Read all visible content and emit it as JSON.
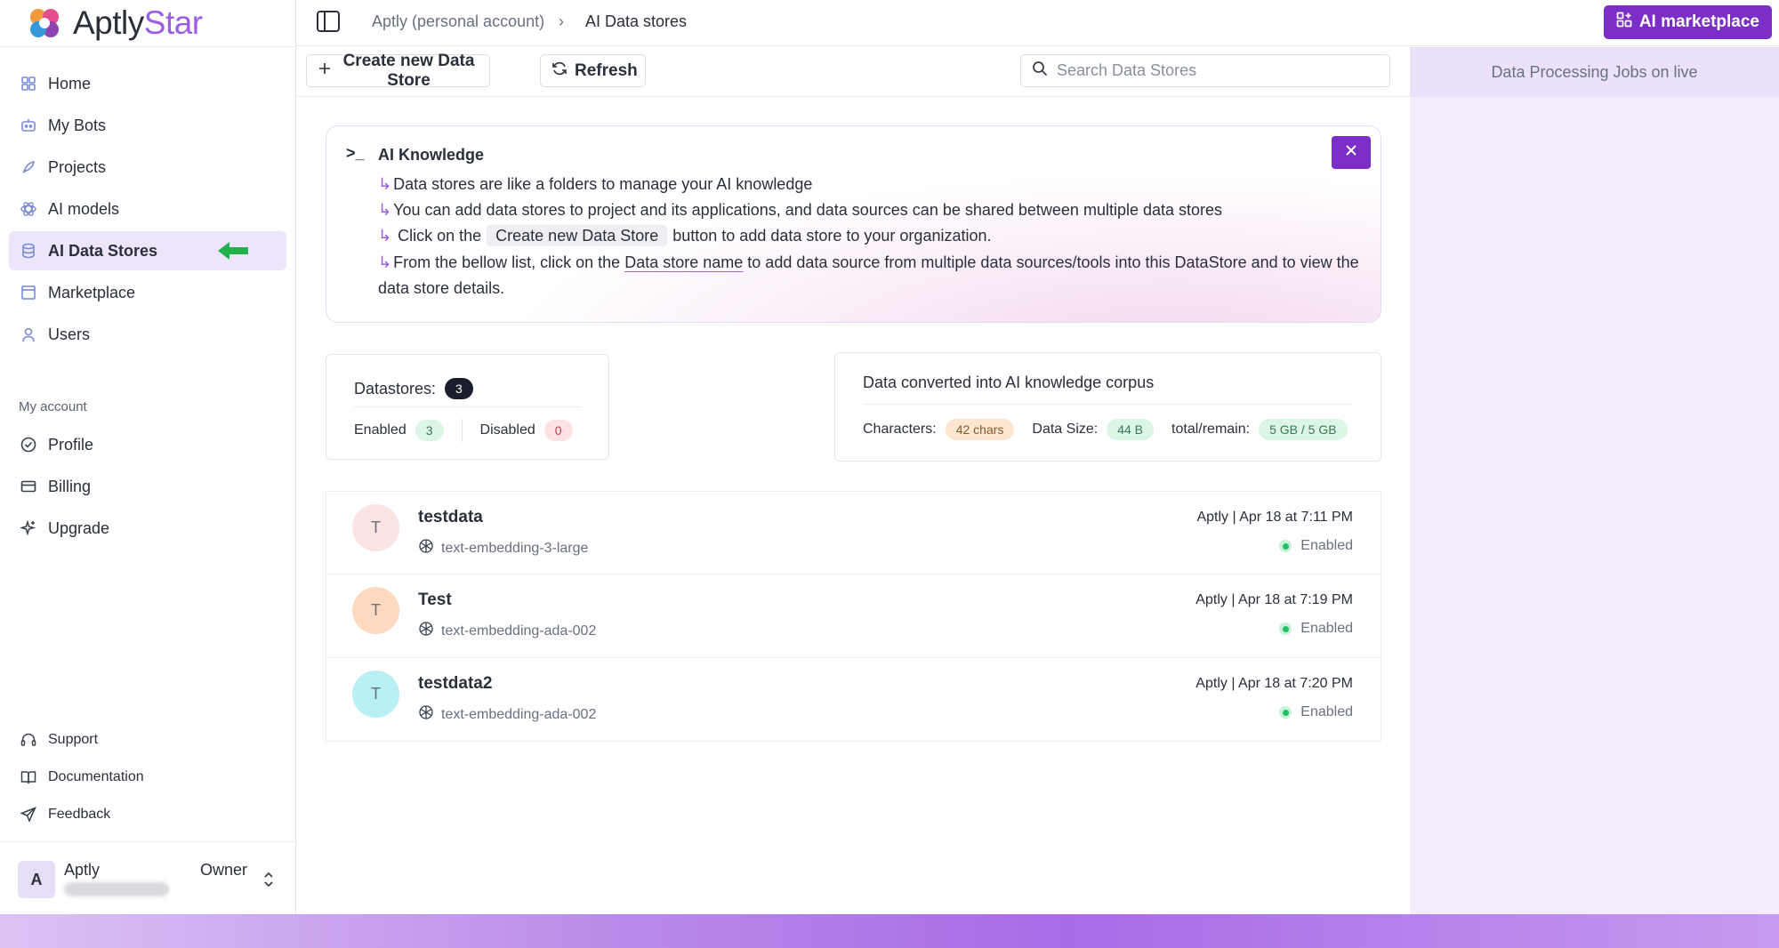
{
  "brand": {
    "name_part1": "Aptly",
    "name_part2": "Star"
  },
  "sidebar": {
    "items": [
      {
        "label": "Home",
        "icon": "home-icon"
      },
      {
        "label": "My Bots",
        "icon": "bot-icon"
      },
      {
        "label": "Projects",
        "icon": "rocket-icon"
      },
      {
        "label": "AI models",
        "icon": "atom-icon"
      },
      {
        "label": "AI Data Stores",
        "icon": "database-icon",
        "active": true
      },
      {
        "label": "Marketplace",
        "icon": "store-icon"
      },
      {
        "label": "Users",
        "icon": "user-icon"
      }
    ],
    "account_section_label": "My account",
    "account_items": [
      {
        "label": "Profile",
        "icon": "check-circle-icon"
      },
      {
        "label": "Billing",
        "icon": "card-icon"
      },
      {
        "label": "Upgrade",
        "icon": "sparkles-icon"
      }
    ],
    "footer_items": [
      {
        "label": "Support",
        "icon": "headset-icon"
      },
      {
        "label": "Documentation",
        "icon": "book-icon"
      },
      {
        "label": "Feedback",
        "icon": "send-icon"
      }
    ],
    "user": {
      "initial": "A",
      "name": "Aptly",
      "role": "Owner"
    }
  },
  "topbar": {
    "breadcrumb_1": "Aptly (personal account)",
    "breadcrumb_sep": "›",
    "breadcrumb_2": "AI Data stores",
    "marketplace_button": "AI marketplace"
  },
  "toolbar": {
    "create_label": "Create new Data Store",
    "refresh_label": "Refresh",
    "search_placeholder": "Search Data Stores"
  },
  "right_panel": {
    "title": "Data Processing Jobs on live"
  },
  "info": {
    "prompt_symbol": ">_",
    "title": "AI Knowledge",
    "hook": "↳",
    "line1": "Data stores are like a folders to manage your AI knowledge",
    "line2": "You can add data stores to project and its applications, and data sources can be shared between multiple data stores",
    "line3_pre": "Click on the",
    "line3_chip": "Create new Data Store",
    "line3_post": "button to add data store to your organization.",
    "line4_pre": "From the bellow list, click on the",
    "line4_link": "Data store name",
    "line4_post": "to add data source from multiple data sources/tools into this DataStore and to view the data store details."
  },
  "stats": {
    "datastores_label": "Datastores:",
    "datastores_count": "3",
    "enabled_label": "Enabled",
    "enabled_count": "3",
    "disabled_label": "Disabled",
    "disabled_count": "0",
    "corpus_title": "Data converted into AI knowledge corpus",
    "characters_label": "Characters:",
    "characters_value": "42 chars",
    "datasize_label": "Data Size:",
    "datasize_value": "44 B",
    "total_label": "total/remain:",
    "total_value": "5 GB / 5 GB"
  },
  "datastores": [
    {
      "initial": "T",
      "name": "testdata",
      "model": "text-embedding-3-large",
      "date": "Aptly | Apr 18 at 7:11 PM",
      "status": "Enabled",
      "avatar_color": "#fbe3e1"
    },
    {
      "initial": "T",
      "name": "Test",
      "model": "text-embedding-ada-002",
      "date": "Aptly | Apr 18 at 7:19 PM",
      "status": "Enabled",
      "avatar_color": "#fcd9bf"
    },
    {
      "initial": "T",
      "name": "testdata2",
      "model": "text-embedding-ada-002",
      "date": "Aptly | Apr 18 at 7:20 PM",
      "status": "Enabled",
      "avatar_color": "#b9f0f3"
    }
  ]
}
